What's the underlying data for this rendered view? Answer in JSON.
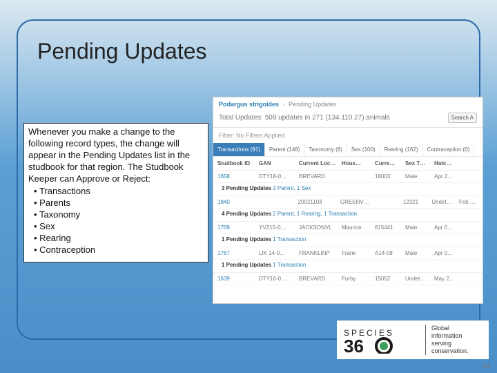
{
  "slide": {
    "title": "Pending Updates",
    "page_number": "14"
  },
  "textbox": {
    "intro": "Whenever you make a change to the following record types, the change will appear in the Pending Updates list in the studbook for that region. The Studbook Keeper can Approve or Reject:",
    "items": [
      "Transactions",
      "Parents",
      "Taxonomy",
      "Sex",
      "Rearing",
      "Contraception"
    ]
  },
  "screenshot": {
    "breadcrumb": {
      "species": "Podargus strigoides",
      "page": "Pending Updates"
    },
    "total_line": "Total Updates: 509 updates in 271 (134.110.27) animals",
    "search_btn": "Search A",
    "filter_line": "Filter: No Filters Applied",
    "tabs": [
      "Transactions (91)",
      "Parent (148)",
      "Taxonomy (8)",
      "Sex (100)",
      "Rearing (162)",
      "Contraception (0)"
    ],
    "columns": [
      "Studbook ID",
      "GAN",
      "Current Loc…",
      "Hous…",
      "Curre…",
      "Sex T…",
      "Hatc…"
    ],
    "rows": [
      {
        "cells": [
          "1658",
          "DTY18-0…",
          "BREVARD",
          "",
          "18003",
          "Male",
          "Apr 2…"
        ],
        "sub": {
          "pfx": "3 Pending Updates",
          "lnk": "2 Parent, 1 Sex"
        }
      },
      {
        "cells": [
          "1840",
          "",
          "20021103",
          "GREENVISC",
          "",
          "12321",
          "Undet…",
          "Feb 0…"
        ],
        "use7": true,
        "sub": {
          "pfx": "4 Pending Updates",
          "lnk": "2 Parent, 1 Rearing, 1 Transaction"
        }
      },
      {
        "cells": [
          "1769",
          "YVZ15-0…",
          "JACKSONVL",
          "Maurice",
          "815441",
          "Male",
          "Apr 0…"
        ],
        "sub": {
          "pfx": "1 Pending Updates",
          "lnk": "1 Transaction"
        }
      },
      {
        "cells": [
          "1767",
          "LIK 14-0…",
          "FRANKLINP",
          "Frank",
          "A14-08",
          "Male",
          "Apr 0…"
        ],
        "sub": {
          "pfx": "1 Pending Updates",
          "lnk": "1 Transaction"
        }
      },
      {
        "cells": [
          "1639",
          "DTY16-0…",
          "BREVARD",
          "Furby",
          "15052",
          "Undet…",
          "May 2…"
        ]
      }
    ]
  },
  "branding": {
    "name_top": "SPECIES",
    "name_bottom": "360",
    "tagline_l1": "Global information",
    "tagline_l2": "serving conservation."
  }
}
